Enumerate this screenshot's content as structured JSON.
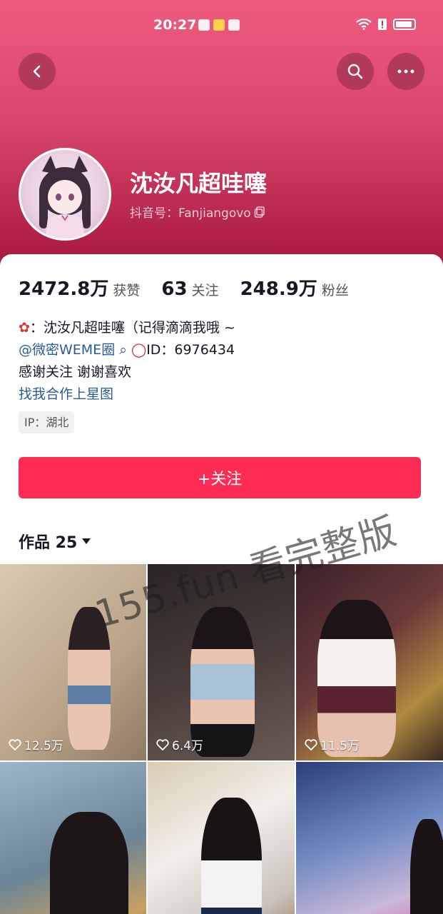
{
  "status_bar": {
    "time": "20:27"
  },
  "nav": {
    "back_icon": "chevron-left-icon",
    "search_icon": "search-icon",
    "more_icon": "more-horizontal-icon"
  },
  "profile": {
    "name": "沈汝凡超哇噻",
    "account_label": "抖音号：Fanjiangovo"
  },
  "stats": [
    {
      "value": "2472.8万",
      "label": "获赞"
    },
    {
      "value": "63",
      "label": "关注"
    },
    {
      "value": "248.9万",
      "label": "粉丝"
    }
  ],
  "bio": {
    "line1": "：沈汝凡超哇噻（记得滴滴我哦 ~",
    "line2_link": "@微密WEME圈",
    "line2_rest": "ID：6976434",
    "line3": "感谢关注 谢谢喜欢",
    "line4_link": "找我合作上星图"
  },
  "ip_tag": "IP：湖北",
  "follow_button": "+关注",
  "works_tab": "作品 25",
  "videos": [
    {
      "likes": "12.5万"
    },
    {
      "likes": "6.4万"
    },
    {
      "likes": "11.5万"
    },
    {
      "likes": ""
    },
    {
      "likes": ""
    },
    {
      "likes": ""
    }
  ],
  "watermark": "155.fun 看完整版",
  "colors": {
    "accent": "#fe2c55",
    "header_top": "#ef5b7f",
    "header_bottom": "#a5163c",
    "link": "#2a5b9c"
  }
}
